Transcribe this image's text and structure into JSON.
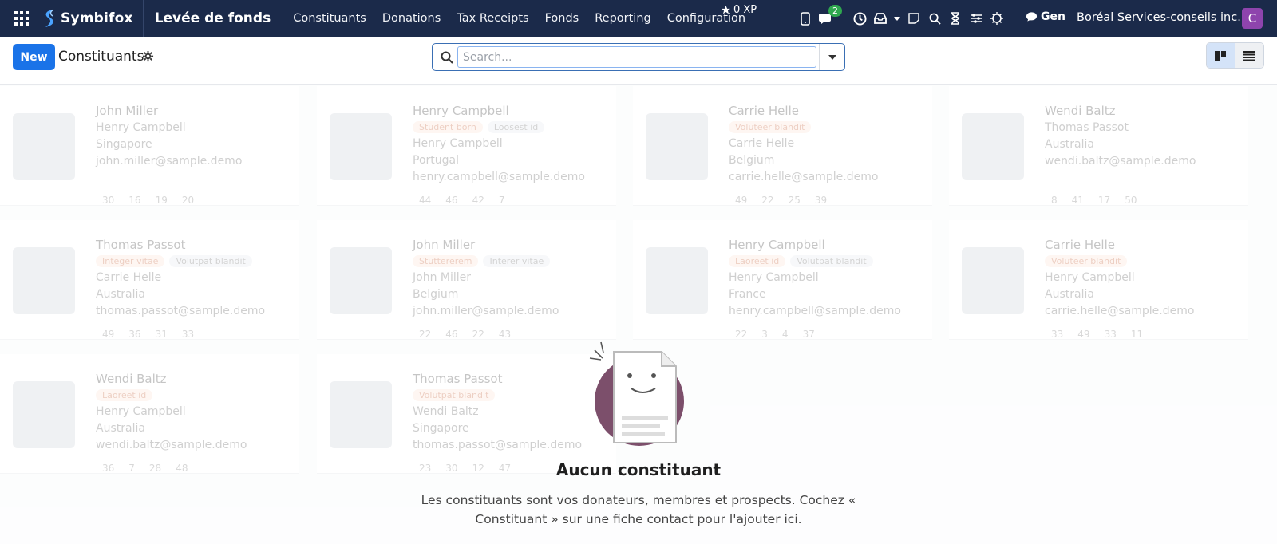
{
  "navbar": {
    "logo_text": "Symbifox",
    "app_name": "Levée de fonds",
    "menu": [
      "Constituants",
      "Donations",
      "Tax Receipts",
      "Fonds",
      "Reporting",
      "Configuration"
    ],
    "xp": "0 XP",
    "messages_badge": "2",
    "gen_label": "Gen",
    "company": "Boréal Services-conseils inc.",
    "avatar_letter": "C",
    "avatar_color": "#8e44ad",
    "bg_color": "#1b2a4a"
  },
  "control": {
    "new_label": "New",
    "title": "Constituants",
    "search_placeholder": "Search..."
  },
  "kanban_cards": [
    {
      "name": "John Miller",
      "tags": [],
      "sub1": "Henry Campbell",
      "sub2": "Singapore",
      "sub3": "john.miller@sample.demo",
      "stats": [
        "30",
        "16",
        "19",
        "20"
      ]
    },
    {
      "name": "Henry Campbell",
      "tags": [
        "Student born",
        "Loosest id"
      ],
      "sub1": "Henry Campbell",
      "sub2": "Portugal",
      "sub3": "henry.campbell@sample.demo",
      "stats": [
        "44",
        "46",
        "42",
        "7"
      ]
    },
    {
      "name": "Carrie Helle",
      "tags": [
        "Voluteer blandit"
      ],
      "sub1": "Carrie Helle",
      "sub2": "Belgium",
      "sub3": "carrie.helle@sample.demo",
      "stats": [
        "49",
        "22",
        "25",
        "39"
      ]
    },
    {
      "name": "Wendi Baltz",
      "tags": [],
      "sub1": "Thomas Passot",
      "sub2": "Australia",
      "sub3": "wendi.baltz@sample.demo",
      "stats": [
        "8",
        "41",
        "17",
        "50"
      ]
    },
    {
      "name": "Thomas Passot",
      "tags": [
        "Integer vitae",
        "Volutpat blandit"
      ],
      "sub1": "Carrie Helle",
      "sub2": "Australia",
      "sub3": "thomas.passot@sample.demo",
      "stats": [
        "49",
        "36",
        "31",
        "33"
      ]
    },
    {
      "name": "John Miller",
      "tags": [
        "Stuttererem",
        "Interer vitae"
      ],
      "sub1": "John Miller",
      "sub2": "Belgium",
      "sub3": "john.miller@sample.demo",
      "stats": [
        "22",
        "46",
        "22",
        "43"
      ]
    },
    {
      "name": "Henry Campbell",
      "tags": [
        "Laoreet id",
        "Volutpat blandit"
      ],
      "sub1": "Henry Campbell",
      "sub2": "France",
      "sub3": "henry.campbell@sample.demo",
      "stats": [
        "22",
        "3",
        "4",
        "37"
      ]
    },
    {
      "name": "Carrie Helle",
      "tags": [
        "Voluteer blandit"
      ],
      "sub1": "Henry Campbell",
      "sub2": "Australia",
      "sub3": "carrie.helle@sample.demo",
      "stats": [
        "33",
        "49",
        "33",
        "11"
      ]
    },
    {
      "name": "Wendi Baltz",
      "tags": [
        "Laoreet id"
      ],
      "sub1": "Henry Campbell",
      "sub2": "Australia",
      "sub3": "wendi.baltz@sample.demo",
      "stats": [
        "36",
        "7",
        "28",
        "48"
      ]
    },
    {
      "name": "Thomas Passot",
      "tags": [
        "Volutpat blandit"
      ],
      "sub1": "Wendi Baltz",
      "sub2": "Singapore",
      "sub3": "thomas.passot@sample.demo",
      "stats": [
        "23",
        "30",
        "12",
        "47"
      ]
    }
  ],
  "empty_state": {
    "title": "Aucun constituant",
    "line1": "Les constituants sont vos donateurs, membres et prospects. Cochez «",
    "line2": "Constituant » sur une fiche contact pour l'ajouter ici."
  }
}
